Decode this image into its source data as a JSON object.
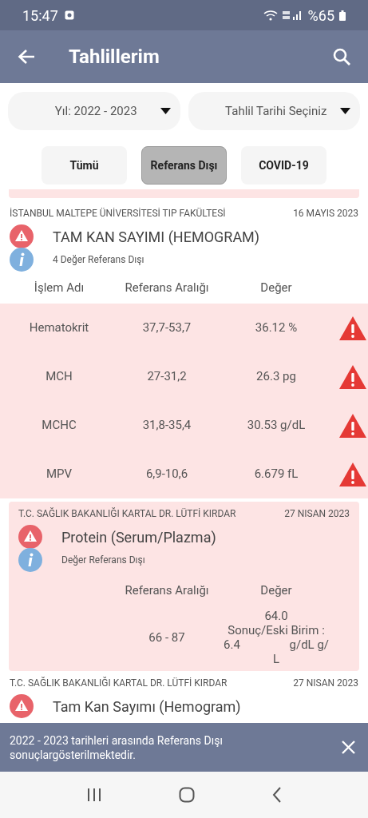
{
  "status_bar": {
    "time": "15:47",
    "battery": "%65"
  },
  "header": {
    "title": "Tahlillerim"
  },
  "filters": [
    {
      "value": "Yıl: 2022 - 2023"
    },
    {
      "value": "Tahlil Tarihi Seçiniz"
    }
  ],
  "tabs": [
    {
      "label": "Tümü",
      "selected": false
    },
    {
      "label": "Referans Dışı",
      "selected": true
    },
    {
      "label": "COVID-19",
      "selected": false
    }
  ],
  "results": [
    {
      "kind": "panel",
      "hospital": "İSTANBUL MALTEPE ÜNİVERSİTESİ TIP FAKÜLTESİ",
      "date": "16 MAYIS 2023",
      "title": "TAM KAN SAYIMI (HEMOGRAM)",
      "info": "4 Değer Referans Dışı",
      "columns": [
        "İşlem Adı",
        "Referans Aralığı",
        "Değer"
      ],
      "rows": [
        {
          "name": "Hematokrit",
          "range": "37,7-53,7",
          "value": "36.12 %",
          "out_of_range": true
        },
        {
          "name": "MCH",
          "range": "27-31,2",
          "value": "26.3 pg",
          "out_of_range": true
        },
        {
          "name": "MCHC",
          "range": "31,8-35,4",
          "value": "30.53 g/dL",
          "out_of_range": true
        },
        {
          "name": "MPV",
          "range": "6,9-10,6",
          "value": "6.679 fL",
          "out_of_range": true
        }
      ]
    },
    {
      "kind": "single",
      "hospital": "T.C. SAĞLIK BAKANLIĞI KARTAL DR. LÜTFİ KIRDAR",
      "date": "27 NISAN 2023",
      "title": "Protein (Serum/Plazma)",
      "info": "Değer Referans Dışı",
      "columns": [
        "Referans Aralığı",
        "Değer"
      ],
      "range": "66 - 87",
      "value_lines": [
        [
          "64.0"
        ],
        [
          "Sonuç/Eski Birim :"
        ],
        [
          "6.4",
          "g/dL g/"
        ],
        [
          "L"
        ]
      ]
    },
    {
      "kind": "clipped",
      "hospital": "T.C. SAĞLIK BAKANLIĞI KARTAL DR. LÜTFİ KIRDAR",
      "date": "27 NISAN 2023",
      "title": "Tam Kan Sayımı (Hemogram)"
    }
  ],
  "snackbar": {
    "message": "2022 - 2023 tarihleri arasında Referans Dışı sonuçlargösterilmektedir."
  }
}
